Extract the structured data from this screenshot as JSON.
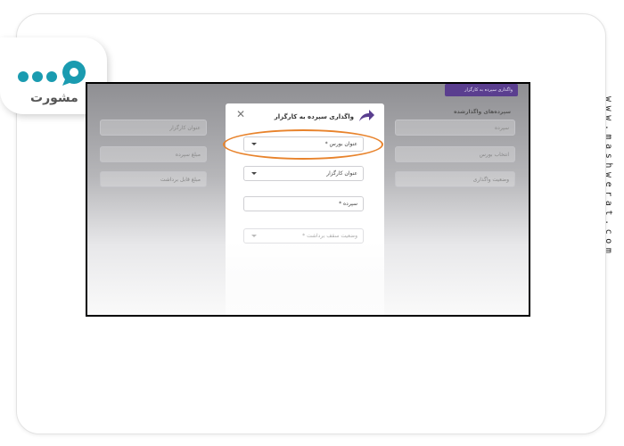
{
  "logo": {
    "text": "مشورت",
    "icon": "speech-bubble-dots-logo",
    "color": "#1a9bb0"
  },
  "site_url": "www.mashwerat.com",
  "background_ui": {
    "topbar_button_label": "واگذاری سپرده به کارگزار",
    "section_heading": "سپرده‌های واگذارشده",
    "left_fields": [
      "عنوان کارگزار",
      "مبلغ سپرده",
      "مبلغ قابل برداشت"
    ],
    "right_fields": [
      "سپرده",
      "انتخاب بورس",
      "وضعیت واگذاری"
    ],
    "accent": "#5a3e8f"
  },
  "dialog": {
    "title": "واگذاری سپرده به کارگزار",
    "close_icon": "close-icon",
    "fields": [
      {
        "label": "عنوان بورس *",
        "type": "select"
      },
      {
        "label": "عنوان کارگزار",
        "type": "select"
      },
      {
        "label": "سپرده *",
        "type": "input"
      },
      {
        "label": "وضعیت سقف برداشت *",
        "type": "select"
      }
    ]
  },
  "highlight_color": "#e8832c"
}
